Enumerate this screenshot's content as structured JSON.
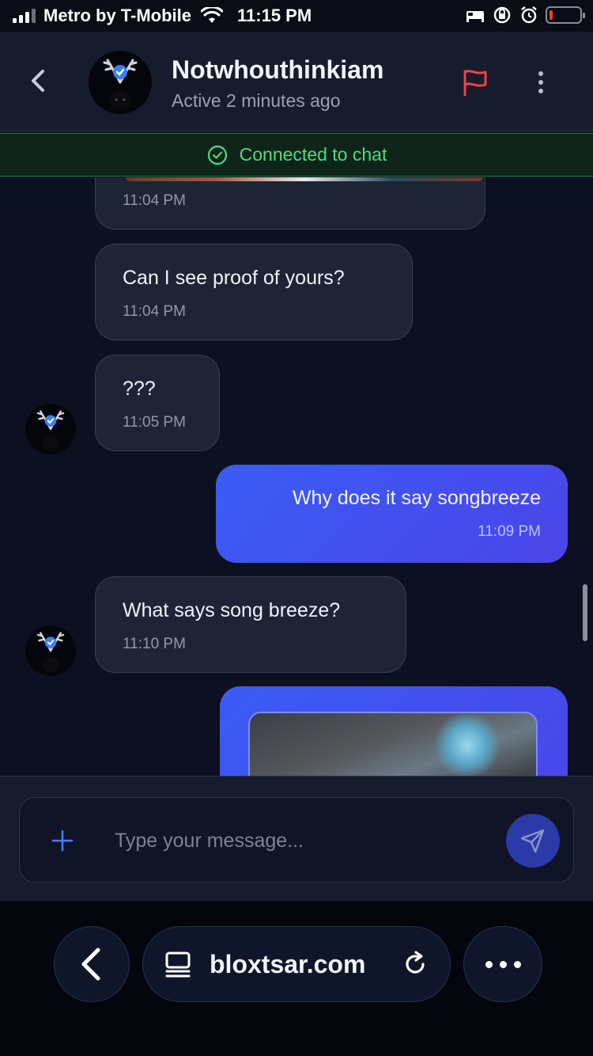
{
  "status_bar": {
    "carrier": "Metro by T-Mobile",
    "time": "11:15 PM"
  },
  "header": {
    "username": "Notwhouthinkiam",
    "status": "Active 2 minutes ago",
    "icons": [
      "back-icon",
      "verified-badge-icon",
      "flag-icon",
      "more-vertical-icon"
    ]
  },
  "banner": {
    "text": "Connected to chat",
    "color": "#4ade80"
  },
  "messages": [
    {
      "direction": "incoming",
      "text": "",
      "time": "11:04 PM",
      "note": ""
    },
    {
      "direction": "incoming",
      "text": "Can I see proof of yours?",
      "time": "11:04 PM"
    },
    {
      "direction": "incoming",
      "text": "???",
      "time": "11:05 PM"
    },
    {
      "direction": "outgoing",
      "text": "Why does it say songbreeze",
      "time": "11:09 PM"
    },
    {
      "direction": "incoming",
      "text": "What says song breeze?",
      "time": "11:10 PM"
    },
    {
      "direction": "outgoing",
      "text": "",
      "time": ""
    }
  ],
  "composer": {
    "placeholder": "Type your message..."
  },
  "browser": {
    "url": "bloxtsar.com",
    "icons": [
      "back-icon",
      "tabs-icon",
      "reload-icon",
      "more-horizontal-icon"
    ]
  },
  "colors": {
    "outgoing_bubble": "#3a5cf5",
    "incoming_bubble": "#1e2436",
    "flag": "#ef4444",
    "accent": "#2b3aa8"
  }
}
